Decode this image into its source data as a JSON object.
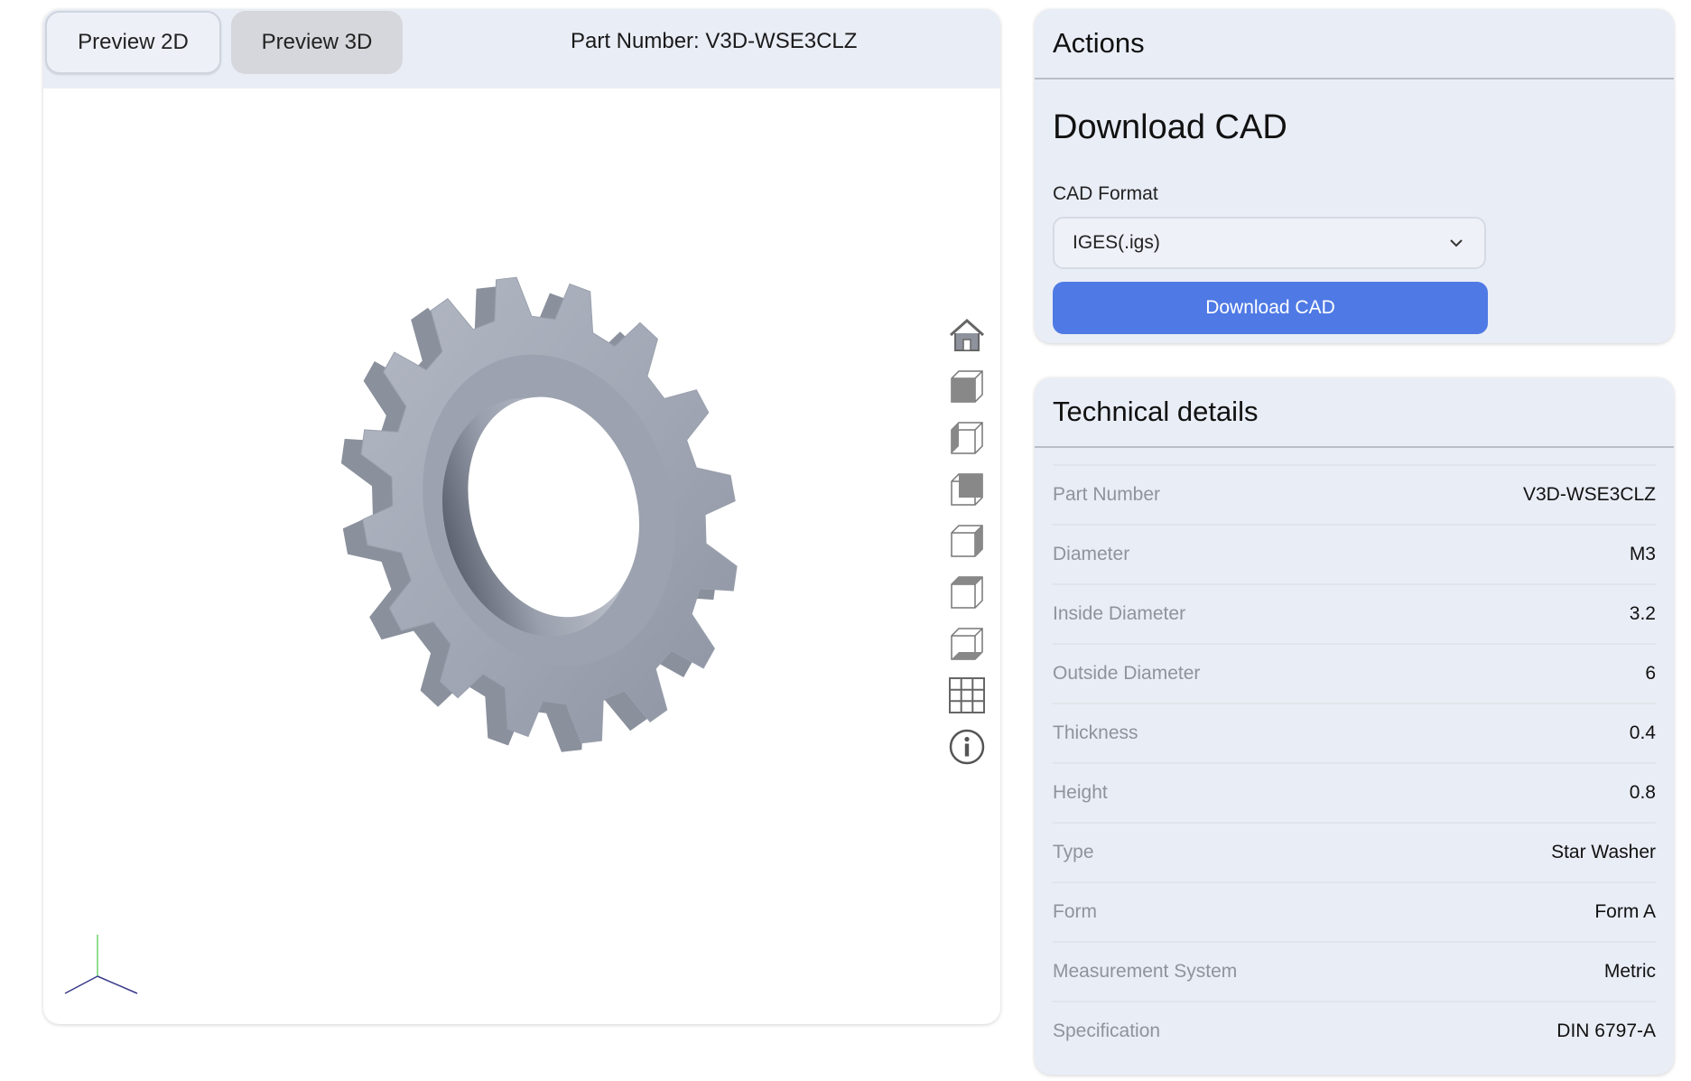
{
  "viewer": {
    "tabs": [
      {
        "label": "Preview 2D",
        "active": false
      },
      {
        "label": "Preview 3D",
        "active": true
      }
    ],
    "part_number_header": "Part Number: V3D-WSE3CLZ",
    "toolbar": [
      {
        "icon": "home-icon"
      },
      {
        "icon": "view-front-cube-icon"
      },
      {
        "icon": "view-left-cube-icon"
      },
      {
        "icon": "view-back-cube-icon"
      },
      {
        "icon": "view-right-cube-icon"
      },
      {
        "icon": "view-top-cube-icon"
      },
      {
        "icon": "view-bottom-cube-icon"
      },
      {
        "icon": "grid-icon"
      },
      {
        "icon": "info-icon"
      }
    ],
    "axis_colors": {
      "x": "#3a3a8a",
      "y": "#6fd36f",
      "z": "#3a3a8a"
    },
    "model_color": "#a1a7b4"
  },
  "actions": {
    "title": "Actions",
    "heading": "Download CAD",
    "format_label": "CAD Format",
    "format_value": "IGES(.igs)",
    "download_label": "Download CAD",
    "accent": "#4f7ae5"
  },
  "tech": {
    "title": "Technical details",
    "rows": [
      {
        "label": "Part Number",
        "value": "V3D-WSE3CLZ"
      },
      {
        "label": "Diameter",
        "value": "M3"
      },
      {
        "label": "Inside Diameter",
        "value": "3.2"
      },
      {
        "label": "Outside Diameter",
        "value": "6"
      },
      {
        "label": "Thickness",
        "value": "0.4"
      },
      {
        "label": "Height",
        "value": "0.8"
      },
      {
        "label": "Type",
        "value": "Star Washer"
      },
      {
        "label": "Form",
        "value": "Form A"
      },
      {
        "label": "Measurement System",
        "value": "Metric"
      },
      {
        "label": "Specification",
        "value": "DIN 6797-A"
      }
    ]
  }
}
